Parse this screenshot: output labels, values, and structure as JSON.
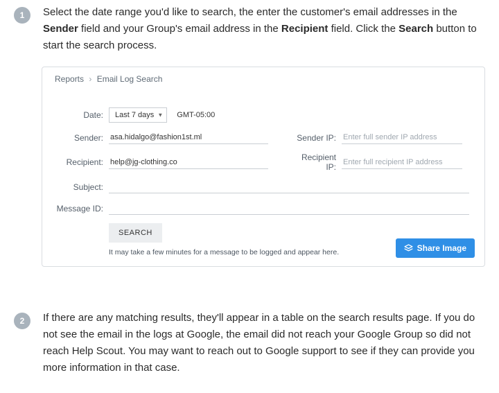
{
  "step1": {
    "number": "1",
    "text_a": "Select the date range you'd like to search, the enter the customer's email addresses in the ",
    "bold_sender": "Sender",
    "text_b": " field and your Group's email address in the ",
    "bold_recipient": "Recipient",
    "text_c": " field. Click the ",
    "bold_search": "Search",
    "text_d": " button to start the search process."
  },
  "panel": {
    "breadcrumb": {
      "root": "Reports",
      "sep": "›",
      "leaf": "Email Log Search"
    },
    "labels": {
      "date": "Date:",
      "sender": "Sender:",
      "recipient": "Recipient:",
      "subject": "Subject:",
      "message_id": "Message ID:",
      "sender_ip": "Sender IP:",
      "recipient_ip": "Recipient IP:"
    },
    "fields": {
      "date_value": "Last 7 days",
      "timezone": "GMT-05:00",
      "sender_value": "asa.hidalgo@fashion1st.ml",
      "recipient_value": "help@jg-clothing.co",
      "subject_value": "",
      "message_id_value": "",
      "sender_ip_placeholder": "Enter full sender IP address",
      "recipient_ip_placeholder": "Enter full recipient IP address"
    },
    "search_button": "SEARCH",
    "note": "It may take a few minutes for a message to be logged and appear here.",
    "share_button": "Share Image"
  },
  "step2": {
    "number": "2",
    "text": "If there are any matching results, they'll appear in a table on the search results page. If you do not see the email in the logs at Google, the email did not reach your Google Group so did not reach Help Scout. You may want to reach out to Google support to see if they can provide you more information in that case."
  }
}
